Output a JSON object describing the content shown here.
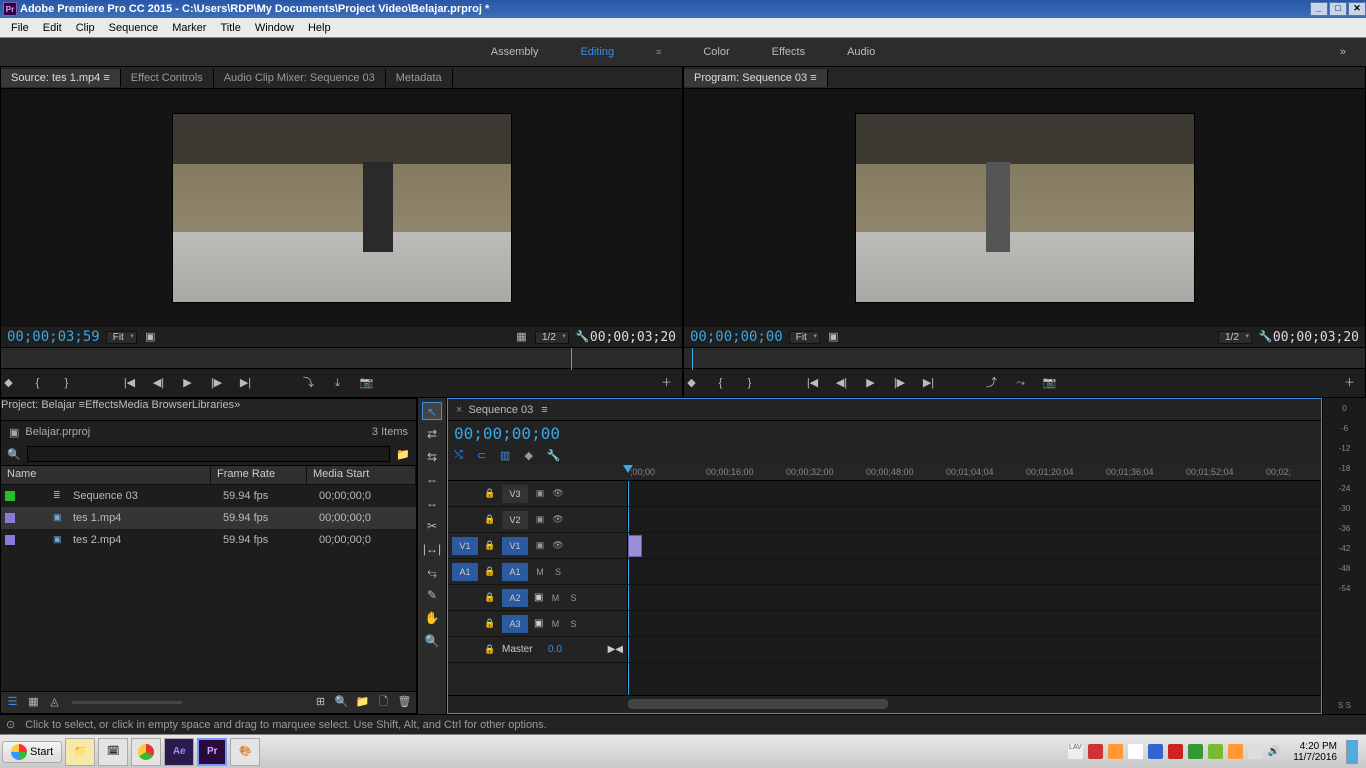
{
  "window": {
    "title": "Adobe Premiere Pro CC 2015 - C:\\Users\\RDP\\My Documents\\Project Video\\Belajar.prproj *",
    "icon_label": "Pr"
  },
  "menu": [
    "File",
    "Edit",
    "Clip",
    "Sequence",
    "Marker",
    "Title",
    "Window",
    "Help"
  ],
  "workspaces": [
    "Assembly",
    "Editing",
    "Color",
    "Effects",
    "Audio"
  ],
  "workspace_active": "Editing",
  "source_panel": {
    "tabs": [
      "Source: tes 1.mp4",
      "Effect Controls",
      "Audio Clip Mixer: Sequence 03",
      "Metadata"
    ],
    "tc_left": "00;00;03;59",
    "tc_right": "00;00;03;20",
    "zoom": "Fit",
    "res": "1/2"
  },
  "program_panel": {
    "tab": "Program: Sequence 03",
    "tc_left": "00;00;00;00",
    "tc_right": "00;00;03;20",
    "zoom": "Fit",
    "res": "1/2"
  },
  "project_panel": {
    "tabs": [
      "Project: Belajar",
      "Effects",
      "Media Browser",
      "Libraries"
    ],
    "filename": "Belajar.prproj",
    "item_count": "3 Items",
    "search_placeholder": "",
    "columns": [
      "Name",
      "Frame Rate",
      "Media Start"
    ],
    "items": [
      {
        "color": "#2cbb2c",
        "icon": "≣",
        "name": "Sequence 03",
        "frame_rate": "59.94 fps",
        "media_start": "00;00;00;0"
      },
      {
        "color": "#8d77d8",
        "icon": "▣",
        "name": "tes 1.mp4",
        "frame_rate": "59.94 fps",
        "media_start": "00;00;00;0"
      },
      {
        "color": "#8d77d8",
        "icon": "▣",
        "name": "tes 2.mp4",
        "frame_rate": "59.94 fps",
        "media_start": "00;00;00;0"
      }
    ]
  },
  "tools": [
    "▲",
    "⇄",
    "⇆",
    "✂",
    "⇔",
    "↔",
    "✎",
    "✋",
    "🔍"
  ],
  "timeline": {
    "tab": "Sequence 03",
    "tc": "00;00;00;00",
    "ruler": [
      ";00;00",
      "00;00;16;00",
      "00;00;32;00",
      "00;00;48;00",
      "00;01;04;04",
      "00;01;20;04",
      "00;01;36;04",
      "00;01;52;04",
      "00;02;"
    ],
    "video_tracks": [
      {
        "label": "V3"
      },
      {
        "label": "V2"
      },
      {
        "label": "V1",
        "src": "V1"
      }
    ],
    "audio_tracks": [
      {
        "label": "A1",
        "src": "A1"
      },
      {
        "label": "A2"
      },
      {
        "label": "A3"
      }
    ],
    "master": {
      "label": "Master",
      "value": "0.0"
    }
  },
  "meters": [
    "0",
    "-6",
    "-12",
    "-18",
    "-24",
    "-30",
    "-36",
    "-42",
    "-48",
    "-54"
  ],
  "status": {
    "hint": "Click to select, or click in empty space and drag to marquee select. Use Shift, Alt, and Ctrl for other options."
  },
  "taskbar": {
    "start": "Start",
    "meters_bottom": "S  S",
    "clock_time": "4:20 PM",
    "clock_date": "11/7/2016"
  }
}
